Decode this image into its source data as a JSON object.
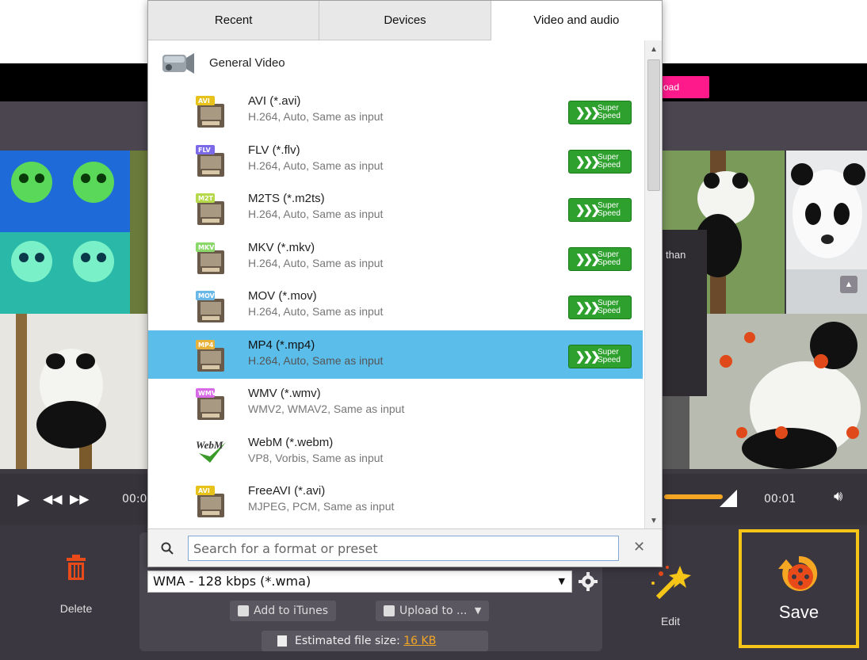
{
  "popup": {
    "tabs": [
      {
        "label": "Recent",
        "active": false
      },
      {
        "label": "Devices",
        "active": false
      },
      {
        "label": "Video and audio",
        "active": true
      }
    ],
    "group": {
      "label": "General Video",
      "icon": "video-camera-icon"
    },
    "formats": [
      {
        "badge": "AVI",
        "badge_color": "#e6c21a",
        "name": "AVI (*.avi)",
        "desc": "H.264, Auto, Same as input",
        "super_speed": true,
        "selected": false
      },
      {
        "badge": "FLV",
        "badge_color": "#7a6ae8",
        "name": "FLV (*.flv)",
        "desc": "H.264, Auto, Same as input",
        "super_speed": true,
        "selected": false
      },
      {
        "badge": "M2T",
        "badge_color": "#b5d94a",
        "name": "M2TS (*.m2ts)",
        "desc": "H.264, Auto, Same as input",
        "super_speed": true,
        "selected": false
      },
      {
        "badge": "MKV",
        "badge_color": "#8ad86a",
        "name": "MKV (*.mkv)",
        "desc": "H.264, Auto, Same as input",
        "super_speed": true,
        "selected": false
      },
      {
        "badge": "MOV",
        "badge_color": "#6ab8e8",
        "name": "MOV (*.mov)",
        "desc": "H.264, Auto, Same as input",
        "super_speed": true,
        "selected": false
      },
      {
        "badge": "MP4",
        "badge_color": "#e8b23a",
        "name": "MP4 (*.mp4)",
        "desc": "H.264, Auto, Same as input",
        "super_speed": true,
        "selected": true
      },
      {
        "badge": "WMV",
        "badge_color": "#d86ae8",
        "name": "WMV (*.wmv)",
        "desc": "WMV2, WMAV2, Same as input",
        "super_speed": false,
        "selected": false
      },
      {
        "badge": "WebM",
        "badge_color": "#3a9a2a",
        "name": "WebM (*.webm)",
        "desc": "VP8, Vorbis, Same as input",
        "super_speed": false,
        "selected": false
      },
      {
        "badge": "AVI",
        "badge_color": "#e6c21a",
        "name": "FreeAVI (*.avi)",
        "desc": "MJPEG, PCM, Same as input",
        "super_speed": false,
        "selected": false
      }
    ],
    "super_speed_line1": "Super",
    "super_speed_line2": "Speed",
    "search_placeholder": "Search for a format or preset",
    "search_value": ""
  },
  "app": {
    "upload_label": "oad",
    "tooltip_text": "than",
    "time_start": "00:0",
    "time_end": "00:01",
    "delete_label": "Delete",
    "format_select_value": "WMA - 128 kbps (*.wma)",
    "add_to_itunes": "Add to iTunes",
    "upload_to": "Upload to ...",
    "estimated_label": "Estimated file size:",
    "estimated_value": "16 KB",
    "edit_label": "Edit",
    "save_label": "Save"
  },
  "colors": {
    "accent_orange": "#f5a623",
    "selection_blue": "#5bbdea",
    "save_highlight": "#f5c518",
    "super_speed_green": "#2ea02e",
    "pink_button": "#ff1a8c"
  }
}
